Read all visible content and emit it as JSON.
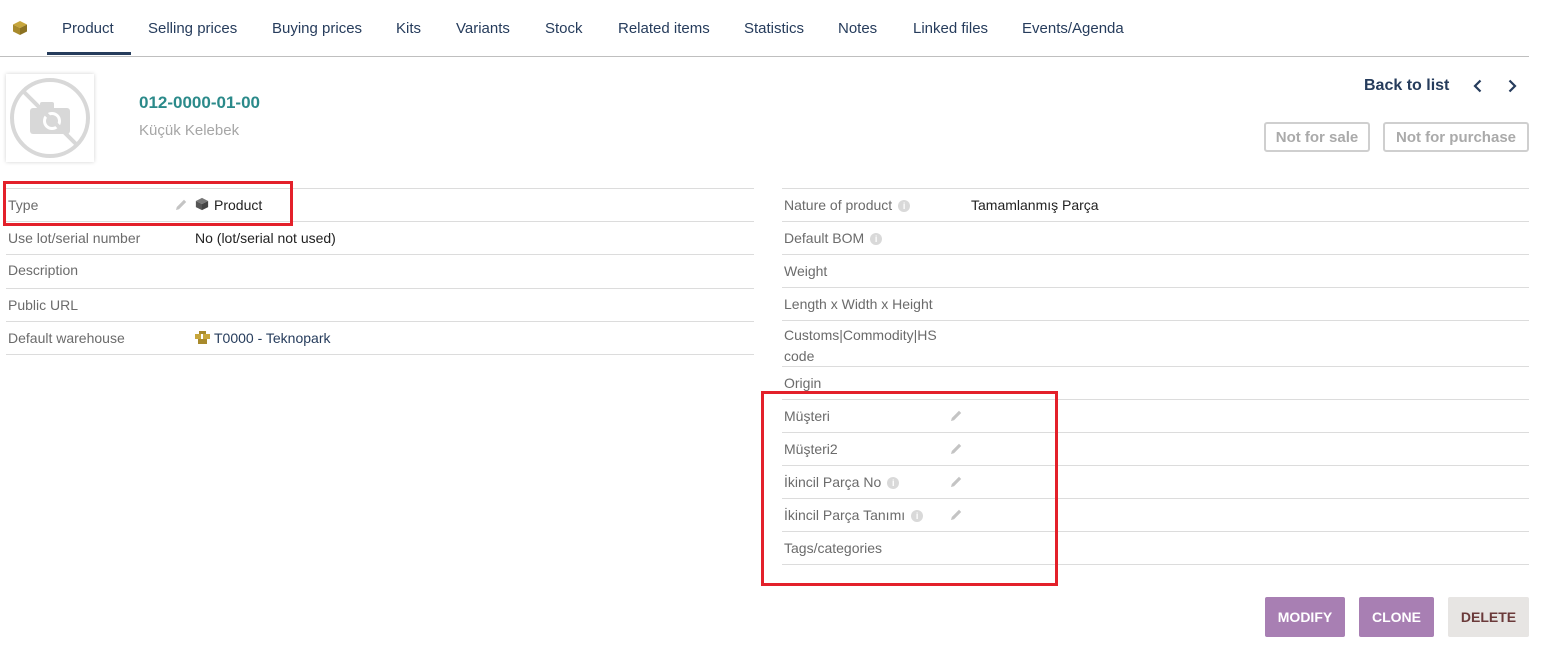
{
  "tabs": [
    "Product",
    "Selling prices",
    "Buying prices",
    "Kits",
    "Variants",
    "Stock",
    "Related items",
    "Statistics",
    "Notes",
    "Linked files",
    "Events/Agenda"
  ],
  "header": {
    "ref": "012-0000-01-00",
    "label": "Küçük Kelebek",
    "back_to_list": "Back to list",
    "status_sale": "Not for sale",
    "status_purchase": "Not for purchase"
  },
  "left_fields": [
    {
      "label": "Type",
      "value": "Product"
    },
    {
      "label": "Use lot/serial number",
      "value": "No (lot/serial not used)"
    },
    {
      "label": "Description",
      "value": ""
    },
    {
      "label": "Public URL",
      "value": ""
    },
    {
      "label": "Default warehouse",
      "value": "T0000 - Teknopark"
    }
  ],
  "right_fields": [
    {
      "label": "Nature of product",
      "value": "Tamamlanmış Parça"
    },
    {
      "label": "Default BOM",
      "value": ""
    },
    {
      "label": "Weight",
      "value": ""
    },
    {
      "label": "Length x Width x Height",
      "value": ""
    },
    {
      "label": "Customs|Commodity|HS code",
      "value": ""
    },
    {
      "label": "Origin",
      "value": ""
    },
    {
      "label": "Müşteri",
      "value": ""
    },
    {
      "label": "Müşteri2",
      "value": ""
    },
    {
      "label": "İkincil Parça No",
      "value": ""
    },
    {
      "label": "İkincil Parça Tanımı",
      "value": ""
    },
    {
      "label": "Tags/categories",
      "value": ""
    }
  ],
  "actions": {
    "modify": "MODIFY",
    "clone": "CLONE",
    "delete": "DELETE"
  },
  "colors": {
    "accent": "#263c5c",
    "ref": "#2b8a8a",
    "highlight": "#e3202a",
    "button_purple": "#a87fb3"
  }
}
